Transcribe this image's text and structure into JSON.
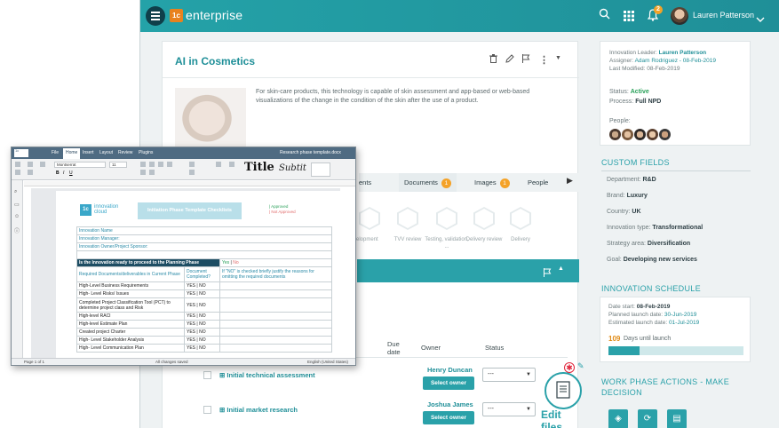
{
  "app": {
    "brand_prefix": "1c",
    "brand": "enterprise",
    "notification_count": "2",
    "user_name": "Lauren Patterson"
  },
  "innovation": {
    "title": "AI in Cosmetics",
    "description": "For skin-care products, this technology is capable of skin assessment and app-based or web-based visualizations of the change in the condition of the skin after the use of a product.",
    "tabs": [
      {
        "label": "ents"
      },
      {
        "label": "Documents",
        "count": "1"
      },
      {
        "label": "Images",
        "count": "1"
      },
      {
        "label": "People"
      }
    ],
    "phases": [
      "Development",
      "TVV review",
      "Testing, validation, ...",
      "Delivery review",
      "Delivery"
    ],
    "table_headers": {
      "due": "Due date",
      "owner": "Owner",
      "status": "Status"
    },
    "tasks": [
      {
        "name": "Initial technical assessment",
        "owner": "Henry Duncan",
        "status": "---",
        "button": "Select owner"
      },
      {
        "name": "Initial market research",
        "owner": "Joshua James",
        "status": "---",
        "button": "Select owner"
      }
    ],
    "edit_files": "Edit files"
  },
  "info": {
    "leader_label": "Innovation Leader:",
    "leader": "Lauren Patterson",
    "assigner_label": "Assigner:",
    "assigner": "Adam Rodriguez - 08-Feb-2019",
    "modified_label": "Last Modified:",
    "modified": "08-Feb-2019",
    "status_label": "Status:",
    "status": "Active",
    "process_label": "Process:",
    "process": "Full NPD",
    "people_label": "People:"
  },
  "custom_fields": {
    "title": "CUSTOM FIELDS",
    "rows": [
      {
        "label": "Department:",
        "value": "R&D"
      },
      {
        "label": "Brand:",
        "value": "Luxury"
      },
      {
        "label": "Country:",
        "value": "UK"
      },
      {
        "label": "Innovation type:",
        "value": "Transformational"
      },
      {
        "label": "Strategy area:",
        "value": "Diversification"
      },
      {
        "label": "Goal:",
        "value": "Developing new services"
      }
    ]
  },
  "schedule": {
    "title": "INNOVATION SCHEDULE",
    "date_start_label": "Date start:",
    "date_start": "08-Feb-2019",
    "planned_label": "Planned launch date:",
    "planned": "30-Jun-2019",
    "estimated_label": "Estimated launch date:",
    "estimated": "01-Jul-2019",
    "days": "109",
    "days_label": "Days until launch",
    "progress": 0.23
  },
  "work_phase": {
    "title_line1": "WORK PHASE ACTIONS - MAKE",
    "title_line2": "DECISION"
  },
  "doc": {
    "menu": [
      "File",
      "Home",
      "Insert",
      "Layout",
      "Review",
      "Plugins"
    ],
    "active_menu": "Home",
    "window_title": "Research phase template.docx",
    "font": "Montserrat",
    "font_size": "11",
    "style1": "Title",
    "style2": "Subtit",
    "logo_small": "1c",
    "logo_text_1": "innovation",
    "logo_text_2": "cloud",
    "banner": "Initiation Phase Template Checklists",
    "approved": "| Approved",
    "not_approved": "| Not Approved",
    "rows": {
      "name": "Innovation Name",
      "manager": "Innovation Manager:",
      "sponsor": "Innovation Owner/Project Sponsor:",
      "question": "Is the Innovation ready to proceed to the Planning Phase",
      "yes": "Yes",
      "no": "No",
      "col1": "Required Documents/deliverables in Current Phase",
      "col2": "Document Completed?",
      "col3": "If \"NO\" is checked briefly justify the reasons for omitting the required documents"
    },
    "items": [
      "High-Level Business Requirements",
      "High- Level Risks/ Issues",
      "Completed Project Classification Tool (PCT) to determine project class and Risk",
      "High-level RACI",
      "High-level Estimate Plan",
      "Created project Charter",
      "High- Level Stakeholder Analysis",
      "High- Level Communication Plan"
    ],
    "yes_lbl": "YES",
    "no_lbl": "NO",
    "status_page": "Page 1 of 1",
    "status_saved": "All changes saved",
    "status_lang": "English (United States)"
  }
}
